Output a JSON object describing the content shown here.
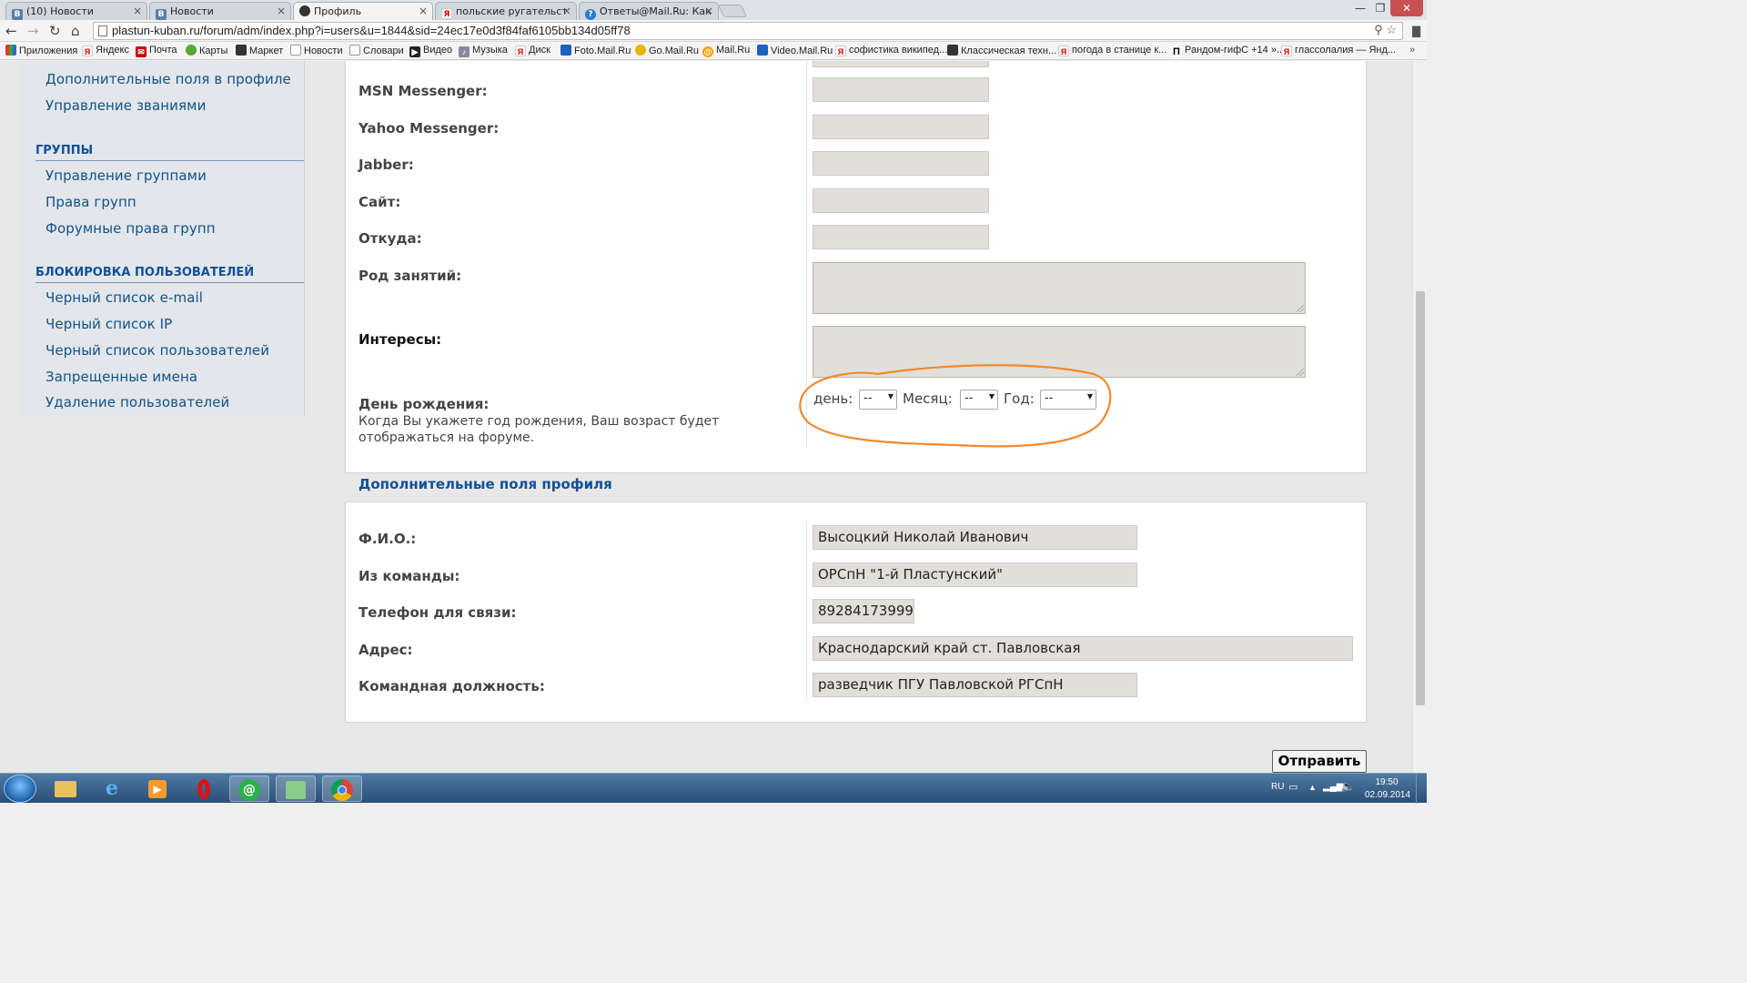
{
  "browser": {
    "tabs": [
      {
        "title": "(10) Новости",
        "icon": "vk-icon",
        "icon_letter": "B"
      },
      {
        "title": "Новости",
        "icon": "vk-icon",
        "icon_letter": "B"
      },
      {
        "title": "Профиль",
        "icon": "forum-icon",
        "icon_letter": "",
        "active": true
      },
      {
        "title": "польские ругательства –",
        "icon": "yandex-icon",
        "icon_letter": "Я"
      },
      {
        "title": "Ответы@Mail.Ru: Как зву",
        "icon": "answers-icon",
        "icon_letter": "?"
      }
    ],
    "url": "plastun-kuban.ru/forum/adm/index.php?i=users&u=1844&sid=24ec17e0d3f84faf6105bb134d05ff78",
    "bookmarks": [
      {
        "label": "Приложения",
        "icon": "apps-grid-icon"
      },
      {
        "label": "Яндекс",
        "icon": "yandex-icon"
      },
      {
        "label": "Почта",
        "icon": "mail-icon"
      },
      {
        "label": "Карты",
        "icon": "maps-icon"
      },
      {
        "label": "Маркет",
        "icon": "market-icon"
      },
      {
        "label": "Новости",
        "icon": "news-icon"
      },
      {
        "label": "Словари",
        "icon": "dictionary-icon"
      },
      {
        "label": "Видео",
        "icon": "video-icon"
      },
      {
        "label": "Музыка",
        "icon": "music-icon"
      },
      {
        "label": "Диск",
        "icon": "disk-icon"
      },
      {
        "label": "Foto.Mail.Ru",
        "icon": "foto-icon"
      },
      {
        "label": "Go.Mail.Ru",
        "icon": "go-icon"
      },
      {
        "label": "Mail.Ru",
        "icon": "mailru-icon"
      },
      {
        "label": "Video.Mail.Ru",
        "icon": "videomail-icon"
      },
      {
        "label": "софистика википед...",
        "icon": "yandex-icon"
      },
      {
        "label": "Классическая техн...",
        "icon": "dog-icon"
      },
      {
        "label": "погода в станице к...",
        "icon": "yandex-icon"
      },
      {
        "label": "Рандом-гифС +14 »...",
        "icon": "pi-icon"
      },
      {
        "label": "глассолалия — Янд...",
        "icon": "yandex-icon"
      }
    ]
  },
  "sidebar": {
    "top_links": [
      "Дополнительные поля в профиле",
      "Управление званиями"
    ],
    "groups_heading": "ГРУППЫ",
    "groups_links": [
      "Управление группами",
      "Права групп",
      "Форумные права групп"
    ],
    "ban_heading": "БЛОКИРОВКА ПОЛЬЗОВАТЕЛЕЙ",
    "ban_links": [
      "Черный список e-mail",
      "Черный список IP",
      "Черный список пользователей",
      "Запрещенные имена",
      "Удаление пользователей"
    ]
  },
  "profile": {
    "msn_label": "MSN Messenger:",
    "yahoo_label": "Yahoo Messenger:",
    "jabber_label": "Jabber:",
    "site_label": "Сайт:",
    "from_label": "Откуда:",
    "occupation_label": "Род занятий:",
    "interests_label": "Интересы:",
    "birthday_label": "День рождения:",
    "birthday_help": "Когда Вы укажете год рождения, Ваш возраст будет отображаться на форуме.",
    "day_label": "день:",
    "month_label": "Месяц:",
    "year_label": "Год:",
    "day_value": "--",
    "month_value": "--",
    "year_value": "--",
    "annotation_color": "#f08a2c"
  },
  "extra": {
    "section_title": "Дополнительные поля профиля",
    "fio_label": "Ф.И.О.:",
    "fio_value": "Высоцкий Николай Иванович",
    "team_label": "Из команды:",
    "team_value": "ОРСпН \"1-й Пластунский\"",
    "phone_label": "Телефон для связи:",
    "phone_value": "89284173999",
    "address_label": "Адрес:",
    "address_value": "Краснодарский край ст. Павловская",
    "position_label": "Командная должность:",
    "position_value": "разведчик ПГУ Павловской РГСпН"
  },
  "submit_label": "Отправить",
  "taskbar": {
    "lang": "RU",
    "time": "19:50",
    "date": "02.09.2014"
  }
}
